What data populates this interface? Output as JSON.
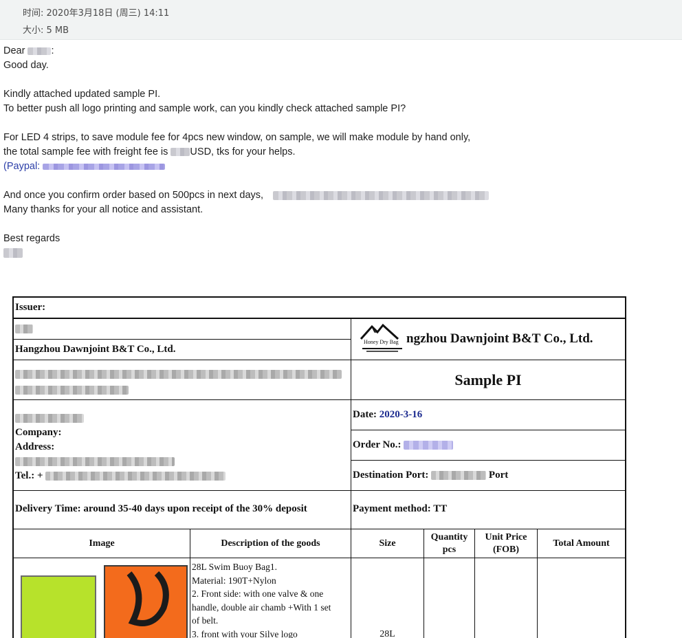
{
  "header": {
    "time_label": "时间: 2020年3月18日 (周三) 14:11",
    "size_label": "大小: 5 MB"
  },
  "body": {
    "dear": "Dear",
    "colon": ":",
    "greeting": "Good day.",
    "line1": "Kindly attached updated sample PI.",
    "line2": "To better push all logo printing and sample work, can you kindly check attached sample PI?",
    "line3": "For LED 4 strips, to save module fee for 4pcs new window, on sample, we will make module by hand only,",
    "line4a": "the total sample fee with freight fee is",
    "line4b": "USD, tks for your helps.",
    "paypal": "(Paypal:",
    "line5": "And once you confirm order based on 500pcs in next days,",
    "line6": "Many thanks for your all notice and assistant.",
    "regards": "Best regards"
  },
  "pi": {
    "issuer": "Issuer:",
    "company": "Hangzhou Dawnjoint B&T Co., Ltd.",
    "company_big": "ngzhou Dawnjoint B&T Co., Ltd.",
    "logo_text": "Honey Dry Bag",
    "title": "Sample PI",
    "company_label": "Company:",
    "address_label": "Address:",
    "tel_label": "Tel.: +",
    "date_label": "Date:",
    "date_value": "2020-3-16",
    "order_label": "Order No.:",
    "dest_label": "Destination Port:",
    "dest_suffix": "Port",
    "delivery": "Delivery Time:  around 35-40 days upon receipt of the 30% deposit",
    "payment": "Payment method: TT",
    "columns": [
      "Image",
      "Description of the goods",
      "Size",
      "Quantity pcs",
      "Unit Price (FOB)",
      "Total Amount"
    ],
    "desc_lines": [
      "28L Swim Buoy Bag1.",
      "Material: 190T+Nylon",
      "2. Front side: with one valve & one",
      "handle, double air chamb +With 1 set",
      "of belt.",
      "3. front with your Silve logo"
    ],
    "size_value": "28L"
  }
}
